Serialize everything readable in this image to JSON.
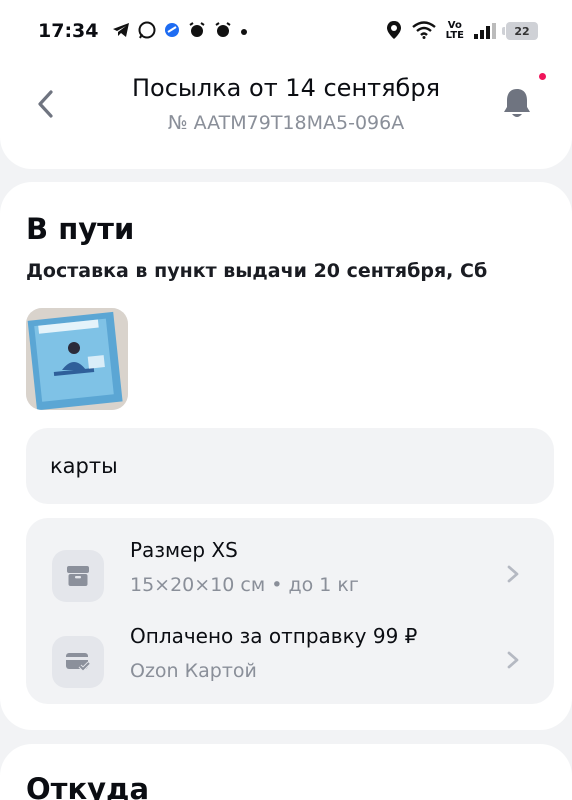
{
  "status_bar": {
    "time": "17:34",
    "battery": "22",
    "left_icons": [
      "telegram-icon",
      "whatsapp-icon",
      "app-icon",
      "alarm-icon",
      "alarm-icon",
      "dot-icon"
    ],
    "right_icons": [
      "location-icon",
      "wifi-icon",
      "volte-icon",
      "signal-icon",
      "battery-icon"
    ],
    "volte_top": "Vo",
    "volte_bottom": "LTE"
  },
  "header": {
    "title": "Посылка от 14 сентября",
    "tracking": "№ AATM79T18MA5-096A",
    "accent_color": "#f0145a"
  },
  "shipment": {
    "status": "В пути",
    "delivery": "Доставка в пункт выдачи 20 сентября, Сб",
    "comment": "карты",
    "size_title": "Размер XS",
    "size_details": "15×20×10 см • до 1 кг",
    "payment_title": "Оплачено за отправку 99 ₽",
    "payment_method": "Ozon Картой"
  },
  "section_from": {
    "title": "Откуда"
  }
}
